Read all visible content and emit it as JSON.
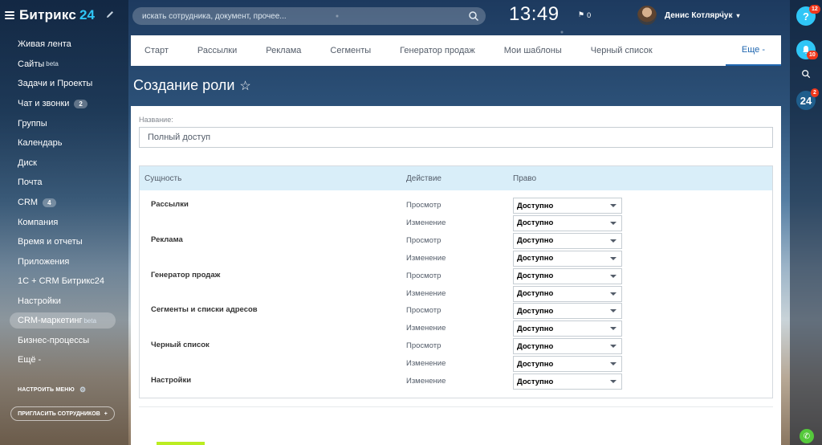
{
  "app": {
    "logo_text": "Битрикс",
    "logo_number": "24"
  },
  "sidebar": {
    "items": [
      {
        "label": "Живая лента"
      },
      {
        "label": "Сайты",
        "sup": "beta"
      },
      {
        "label": "Задачи и Проекты"
      },
      {
        "label": "Чат и звонки",
        "badge": "2"
      },
      {
        "label": "Группы"
      },
      {
        "label": "Календарь"
      },
      {
        "label": "Диск"
      },
      {
        "label": "Почта"
      },
      {
        "label": "CRM",
        "badge": "4"
      },
      {
        "label": "Компания"
      },
      {
        "label": "Время и отчеты"
      },
      {
        "label": "Приложения"
      },
      {
        "label": "1С + CRM Битрикс24"
      },
      {
        "label": "Настройки"
      },
      {
        "label": "CRM-маркетинг",
        "sup": "beta",
        "active": true
      },
      {
        "label": "Бизнес-процессы"
      },
      {
        "label": "Ещё -"
      }
    ],
    "setup_menu": "НАСТРОИТЬ МЕНЮ",
    "invite": "ПРИГЛАСИТЬ СОТРУДНИКОВ"
  },
  "header": {
    "search_placeholder": "искать сотрудника, документ, прочее...",
    "clock": "13:49",
    "flag_count": "0",
    "user_name": "Денис Котлярчук"
  },
  "right_bar": {
    "help_badge": "12",
    "notify_badge": "10",
    "b24_label": "24",
    "b24_badge": "2"
  },
  "tabs": [
    "Старт",
    "Рассылки",
    "Реклама",
    "Сегменты",
    "Генератор продаж",
    "Мои шаблоны",
    "Черный список"
  ],
  "tab_more": "Еще -",
  "page": {
    "title": "Создание роли",
    "name_label": "Название:",
    "name_value": "Полный доступ"
  },
  "table": {
    "headers": {
      "entity": "Сущность",
      "action": "Действие",
      "right": "Право"
    },
    "rows": [
      {
        "entity": "Рассылки",
        "action": "Просмотр",
        "right": "Доступно"
      },
      {
        "entity": "",
        "action": "Изменение",
        "right": "Доступно"
      },
      {
        "entity": "Реклама",
        "action": "Просмотр",
        "right": "Доступно"
      },
      {
        "entity": "",
        "action": "Изменение",
        "right": "Доступно"
      },
      {
        "entity": "Генератор продаж",
        "action": "Просмотр",
        "right": "Доступно"
      },
      {
        "entity": "",
        "action": "Изменение",
        "right": "Доступно"
      },
      {
        "entity": "Сегменты и списки адресов",
        "action": "Просмотр",
        "right": "Доступно"
      },
      {
        "entity": "",
        "action": "Изменение",
        "right": "Доступно"
      },
      {
        "entity": "Черный список",
        "action": "Просмотр",
        "right": "Доступно"
      },
      {
        "entity": "",
        "action": "Изменение",
        "right": "Доступно"
      },
      {
        "entity": "Настройки",
        "action": "Изменение",
        "right": "Доступно"
      }
    ]
  }
}
